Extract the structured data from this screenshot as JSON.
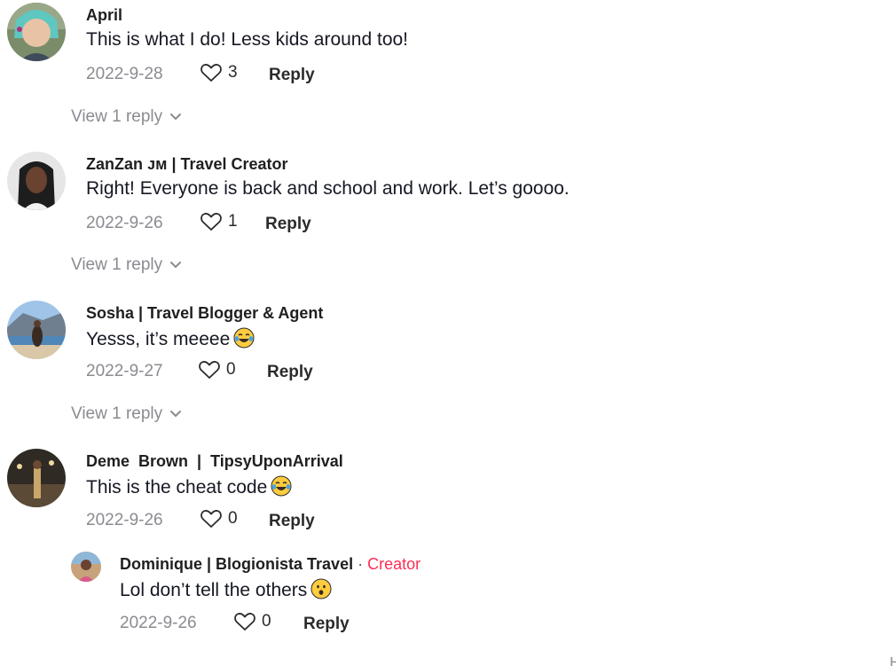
{
  "comments": [
    {
      "username": "April",
      "text": "This is what I do! Less kids around too!",
      "date": "2022-9-28",
      "likes": "3",
      "reply_label": "Reply",
      "view_replies": "View 1 reply"
    },
    {
      "username": "ZanZan ᴊᴍ | Travel Creator",
      "text": "Right! Everyone is back and school and work. Let’s goooo.",
      "date": "2022-9-26",
      "likes": "1",
      "reply_label": "Reply",
      "view_replies": "View 1 reply"
    },
    {
      "username": "Sosha | Travel Blogger & Agent",
      "text": "Yesss, it’s meeee",
      "emoji": "face-with-tears-of-joy",
      "date": "2022-9-27",
      "likes": "0",
      "reply_label": "Reply",
      "view_replies": "View 1 reply"
    },
    {
      "username": "Deme  Brown  |  TipsyUponArrival",
      "text": "This is the cheat code",
      "emoji": "face-with-tears-of-joy",
      "date": "2022-9-26",
      "likes": "0",
      "reply_label": "Reply",
      "reply": {
        "username": "Dominique | Blogionista Travel",
        "separator": "·",
        "creator_label": "Creator",
        "text": "Lol don’t tell the others",
        "emoji": "hushed-face",
        "date": "2022-9-26",
        "likes": "0",
        "reply_label": "Reply"
      }
    }
  ],
  "edge_text": "Hi",
  "colors": {
    "creator": "#fe2c55",
    "muted": "#8a8b91",
    "text": "#161823"
  }
}
